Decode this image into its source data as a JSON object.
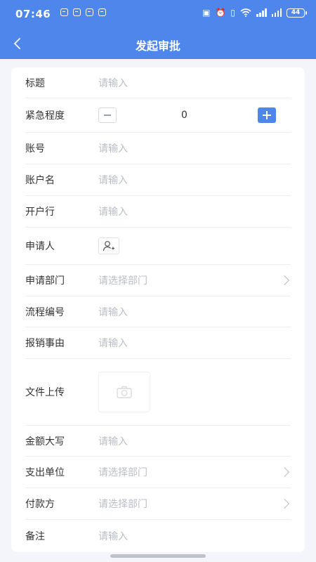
{
  "status_bar": {
    "time": "07:46",
    "battery": "44"
  },
  "nav": {
    "title": "发起审批"
  },
  "form": {
    "title": {
      "label": "标题",
      "placeholder": "请输入"
    },
    "urgency": {
      "label": "紧急程度",
      "value": "0"
    },
    "account_no": {
      "label": "账号",
      "placeholder": "请输入"
    },
    "account_name": {
      "label": "账户名",
      "placeholder": "请输入"
    },
    "bank": {
      "label": "开户行",
      "placeholder": "请输入"
    },
    "applicant": {
      "label": "申请人"
    },
    "department": {
      "label": "申请部门",
      "placeholder": "请选择部门"
    },
    "process_no": {
      "label": "流程编号",
      "placeholder": "请输入"
    },
    "reason": {
      "label": "报销事由",
      "placeholder": "请输入"
    },
    "upload": {
      "label": "文件上传"
    },
    "amount_caps": {
      "label": "金额大写",
      "placeholder": "请输入"
    },
    "expense_unit": {
      "label": "支出单位",
      "placeholder": "请选择部门"
    },
    "payer": {
      "label": "付款方",
      "placeholder": "请选择部门"
    },
    "remark": {
      "label": "备注",
      "placeholder": "请输入"
    }
  },
  "colors": {
    "primary": "#4f86ec",
    "background": "#f3f5fa",
    "placeholder": "#b9bdc6"
  },
  "icons": [
    "back-icon",
    "minus-icon",
    "plus-icon",
    "add-user-icon",
    "camera-icon",
    "chevron-right-icon"
  ]
}
